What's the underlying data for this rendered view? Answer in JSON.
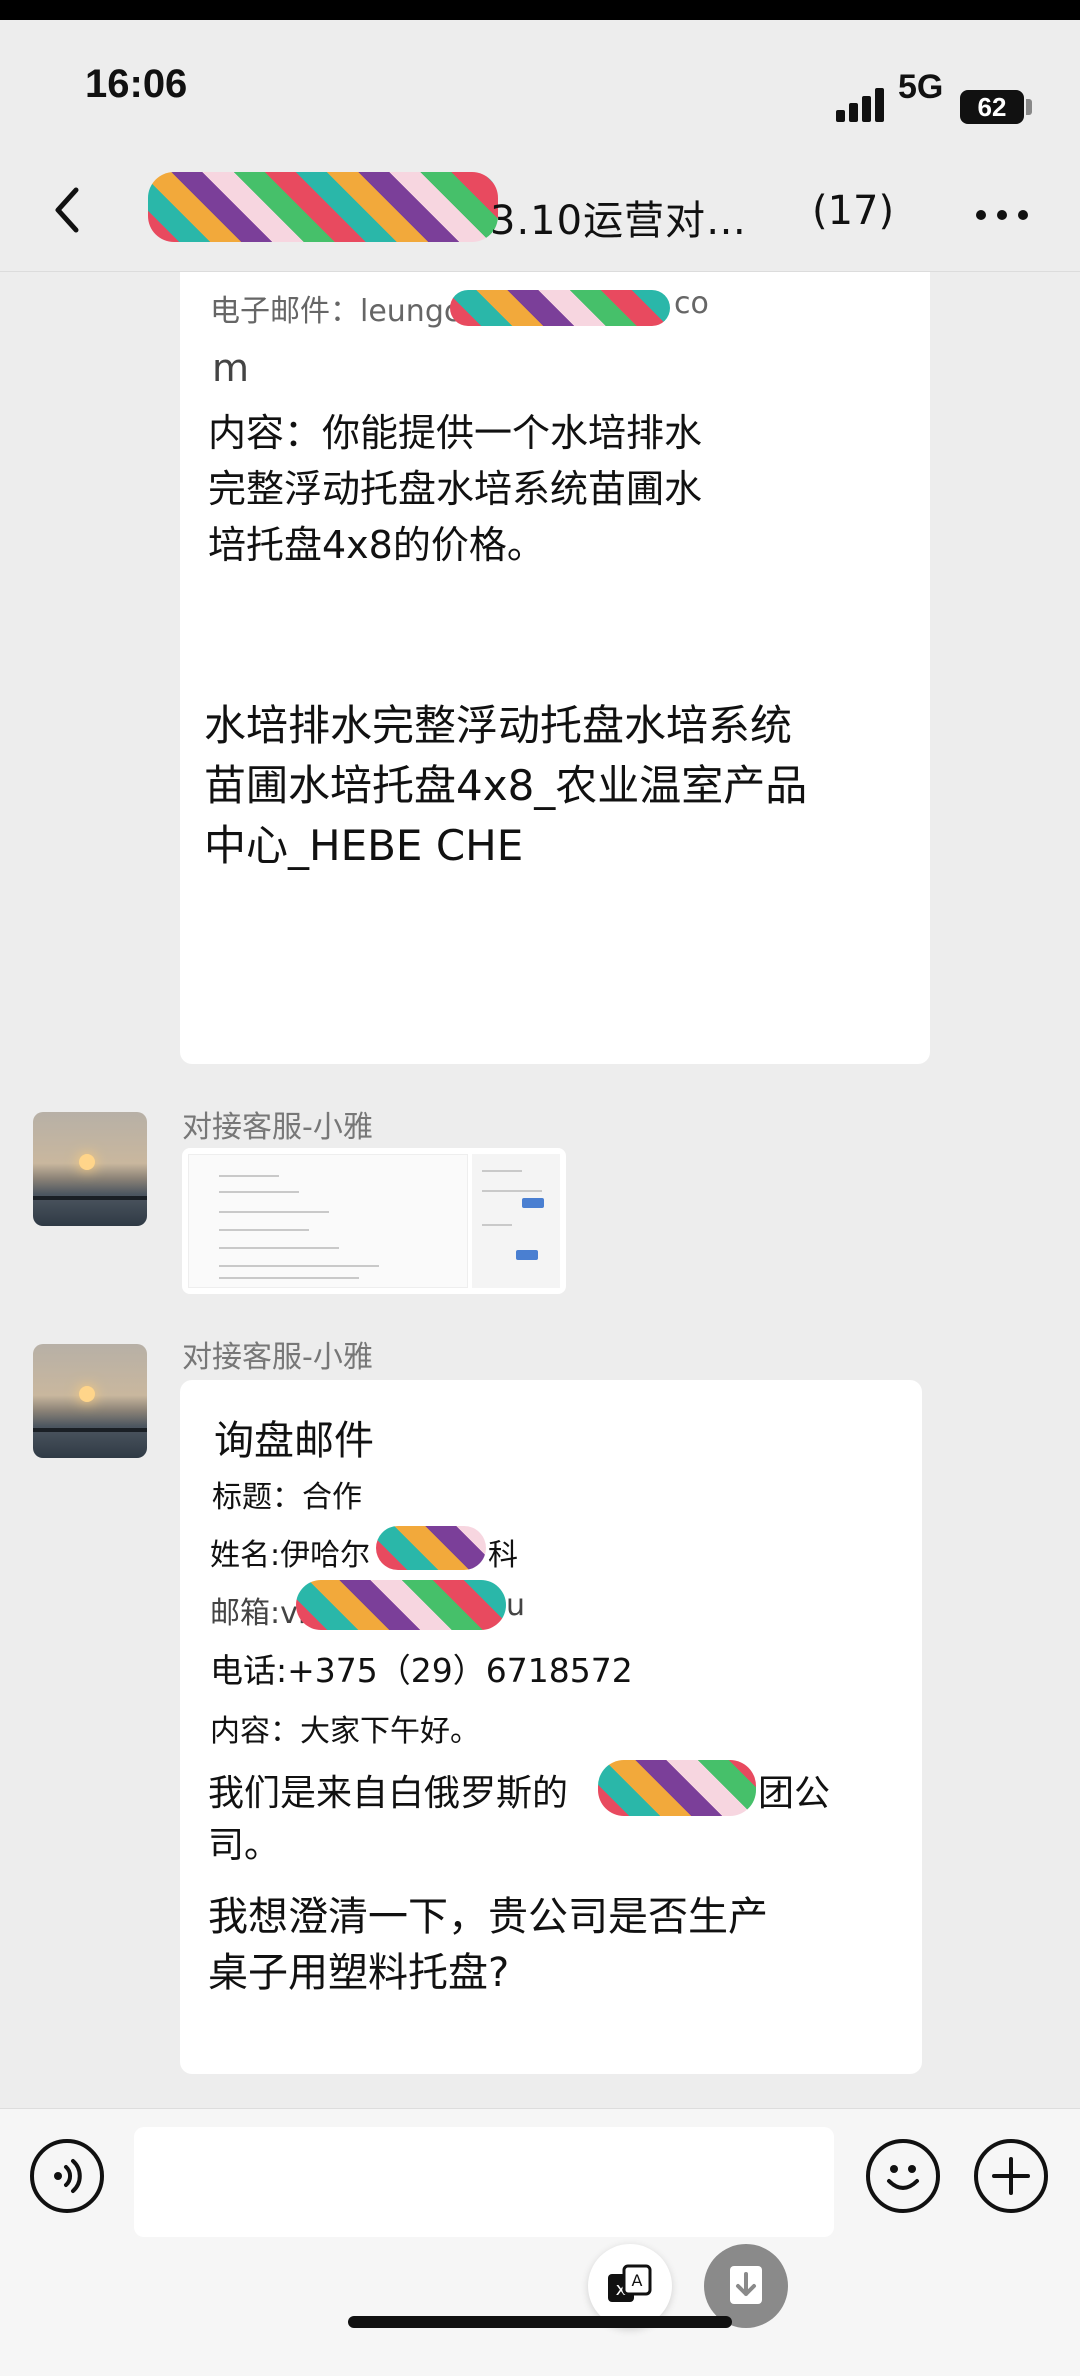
{
  "status_bar": {
    "time": "16:06",
    "network": "5G",
    "battery": "62"
  },
  "header": {
    "title": "3.10运营对…",
    "count": "(17)"
  },
  "messages": {
    "email1": {
      "email_prefix": "电子邮件：leungc",
      "email_suffix": "co",
      "email_wrap": "m",
      "content_lines": [
        "内容：你能提供一个水培排水",
        "完整浮动托盘水培系统苗圃水",
        "培托盘4x8的价格。"
      ],
      "product_lines": [
        "水培排水完整浮动托盘水培系统",
        "苗圃水培托盘4x8_农业温室产品",
        "中心_HEBE CHE"
      ]
    },
    "msg2": {
      "sender": "对接客服-小雅"
    },
    "msg3": {
      "sender": "对接客服-小雅",
      "heading": "询盘邮件",
      "subject": "标题：合作",
      "name": "姓名:伊哈尔",
      "name_suffix": "科",
      "email_prefix": "邮箱:vi",
      "email_suffix": "u",
      "phone": "电话:+375（29）6718572",
      "content": "内容：大家下午好。",
      "line1a": "我们是来自白俄罗斯的",
      "line1b": "团公",
      "line1c": "司。",
      "line2a": "我想澄清一下，贵公司是否生产",
      "line2b": "桌子用塑料托盘?"
    }
  },
  "icons": {
    "back": "chevron-left-icon",
    "more": "more-dots-icon",
    "voice": "voice-icon",
    "emoji": "emoji-icon",
    "add": "plus-icon",
    "translate": "translate-icon",
    "download": "download-icon"
  }
}
